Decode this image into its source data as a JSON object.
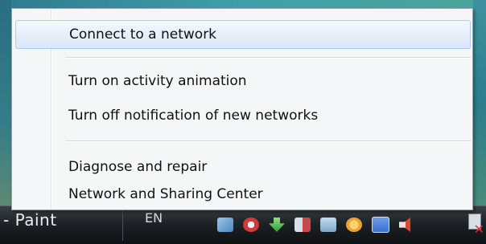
{
  "menu": {
    "items": [
      {
        "label": "Connect to a network",
        "highlighted": true
      },
      {
        "label": "Turn on activity animation",
        "highlighted": false
      },
      {
        "label": "Turn off notification of new networks",
        "highlighted": false
      },
      {
        "label": "Diagnose and repair",
        "highlighted": false
      },
      {
        "label": "Network and Sharing Center",
        "highlighted": false
      }
    ]
  },
  "taskbar": {
    "app_label": "- Paint",
    "language": "EN",
    "tray_icons": [
      {
        "name": "network-icon",
        "color": "#6fa8d8"
      },
      {
        "name": "shield-icon",
        "color": "#d03a3a"
      },
      {
        "name": "download-icon",
        "color": "#3cb54a"
      },
      {
        "name": "display-icon",
        "color": "#c94a4a"
      },
      {
        "name": "monitor-icon",
        "color": "#7da6c9"
      },
      {
        "name": "security-alert-icon",
        "color": "#e8a33a"
      },
      {
        "name": "screen-icon",
        "color": "#3b6fd0"
      },
      {
        "name": "volume-icon",
        "color": "#d94a2a"
      }
    ]
  },
  "colors": {
    "menu_background": "#f5f6f8",
    "highlight_border": "#aecbf0",
    "taskbar": "#1d2226"
  }
}
